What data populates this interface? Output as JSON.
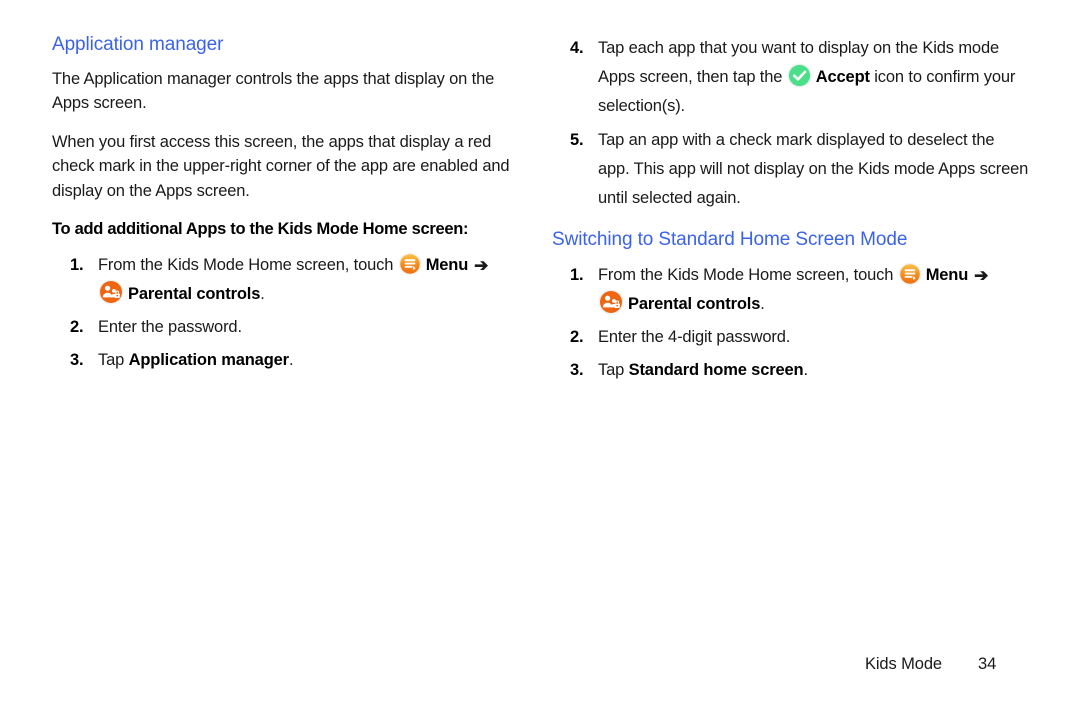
{
  "page": {
    "heading_color": "#3b63e8",
    "background": "#ffffff"
  },
  "left_column": {
    "heading": "Application manager",
    "paragraphs": [
      "The Application manager controls the apps that display on the Apps screen.",
      "When you first access this screen, the apps that display a red check mark in the upper-right corner of the app are enabled and display on the Apps screen."
    ],
    "lead_in": "To add additional Apps to the Kids Mode Home screen:",
    "steps": [
      {
        "num": "1.",
        "text_before_menu_icon": "From the Kids Mode Home screen, touch ",
        "menu_label": "Menu",
        "arrow": "➔",
        "parental_label": "Parental controls",
        "trailing": "."
      },
      {
        "num": "2.",
        "text": "Enter the password."
      },
      {
        "num": "3.",
        "text_before_bold": "Tap ",
        "bold": "Application manager",
        "text_after_bold": "."
      }
    ]
  },
  "right_column": {
    "steps_continued": [
      {
        "num": "4.",
        "text_before_icon": "Tap each app that you want to display on the Kids mode Apps screen, then tap the ",
        "accept_label": "Accept",
        "text_after_icon": " icon to confirm your selection(s)."
      },
      {
        "num": "5.",
        "text": "Tap an app with a check mark displayed to deselect the app. This app will not display on the Kids mode Apps screen until selected again."
      }
    ],
    "heading": "Switching to Standard Home Screen Mode",
    "steps": [
      {
        "num": "1.",
        "text_before_menu_icon": "From the Kids Mode Home screen, touch ",
        "menu_label": "Menu",
        "arrow": "➔",
        "parental_label": "Parental controls",
        "trailing": "."
      },
      {
        "num": "2.",
        "text": "Enter the 4-digit password."
      },
      {
        "num": "3.",
        "text_before_bold": "Tap ",
        "bold": "Standard home screen",
        "text_after_bold": "."
      }
    ]
  },
  "icons": {
    "menu": {
      "name": "menu-icon",
      "color_outer": "#f5a623",
      "color_inner": "#ef7215"
    },
    "parental_controls": {
      "name": "parental-controls-icon",
      "color": "#ee6611"
    },
    "accept": {
      "name": "accept-icon",
      "color": "#4ae08a"
    }
  },
  "footer": {
    "title": "Kids Mode",
    "page_number": "34"
  }
}
